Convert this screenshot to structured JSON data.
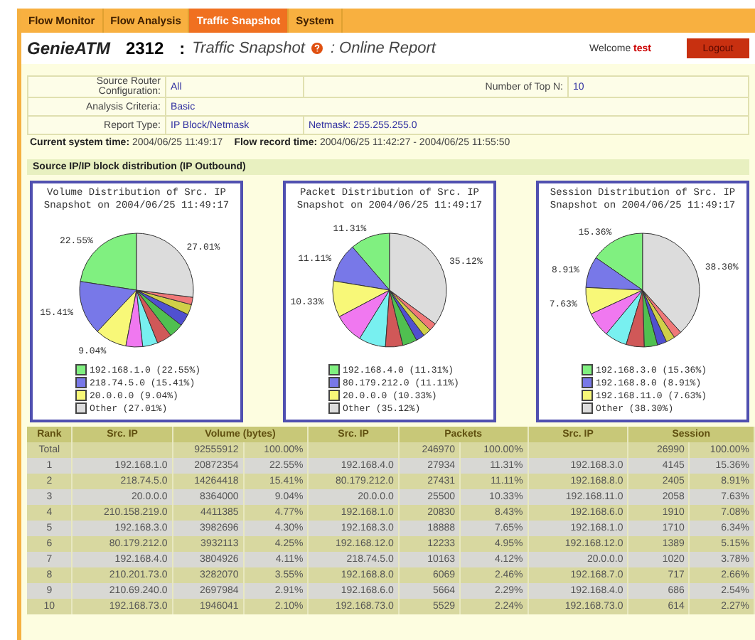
{
  "nav": [
    {
      "label": "Flow Monitor",
      "selected": false
    },
    {
      "label": "Flow Analysis",
      "selected": false
    },
    {
      "label": "Traffic Snapshot",
      "selected": true
    },
    {
      "label": "System",
      "selected": false
    }
  ],
  "header": {
    "product": "GenieATM",
    "model": "2312",
    "separator": ":",
    "section": "Traffic Snapshot",
    "page": ": Online Report",
    "welcome": "Welcome",
    "user": "test",
    "logout": "Logout"
  },
  "filters": {
    "source_label": "Source Router Configuration:",
    "source_value": "All",
    "topn_label": "Number of Top N:",
    "topn_value": "10",
    "criteria_label": "Analysis Criteria:",
    "criteria_value": "Basic",
    "report_label": "Report Type:",
    "report_value": "IP Block/Netmask",
    "netmask": "Netmask: 255.255.255.0"
  },
  "times": {
    "system_label": "Current system time:",
    "system_value": "2004/06/25 11:49:17",
    "flow_label": "Flow record time:",
    "flow_value": "2004/06/25 11:42:27 - 2004/06/25 11:55:50"
  },
  "section_title": "Source IP/IP block distribution (IP Outbound)",
  "charts": [
    {
      "title_lines": [
        "Volume Distribution of Src. IP",
        "Snapshot on 2004/06/25 11:49:17"
      ],
      "chart_data": {
        "type": "pie",
        "values": [
          22.55,
          15.41,
          9.04,
          4.77,
          4.3,
          4.25,
          4.11,
          3.55,
          2.91,
          2.1,
          27.01
        ],
        "colors": [
          "#80f080",
          "#7878e8",
          "#f8f878",
          "#f078f0",
          "#78f0f0",
          "#d05858",
          "#50c050",
          "#5050d0",
          "#d0d048",
          "#f07878",
          "#dcdcdc"
        ],
        "value_labels": [
          "22.55%",
          "15.41%",
          "9.04%",
          null,
          null,
          null,
          null,
          null,
          null,
          null,
          "27.01%"
        ]
      },
      "legend": [
        {
          "label": "192.168.1.0 (22.55%)",
          "color": "#80f080"
        },
        {
          "label": "218.74.5.0 (15.41%)",
          "color": "#7878e8"
        },
        {
          "label": "20.0.0.0 (9.04%)",
          "color": "#f8f878"
        },
        {
          "label": "Other (27.01%)",
          "color": "#dcdcdc"
        }
      ]
    },
    {
      "title_lines": [
        "Packet Distribution of Src. IP",
        "Snapshot on 2004/06/25 11:49:17"
      ],
      "chart_data": {
        "type": "pie",
        "values": [
          11.31,
          11.11,
          10.33,
          8.43,
          7.65,
          4.95,
          4.12,
          2.46,
          2.29,
          2.24,
          35.12
        ],
        "colors": [
          "#80f080",
          "#7878e8",
          "#f8f878",
          "#f078f0",
          "#78f0f0",
          "#d05858",
          "#50c050",
          "#5050d0",
          "#d0d048",
          "#f07878",
          "#dcdcdc"
        ],
        "value_labels": [
          "11.31%",
          "11.11%",
          "10.33%",
          null,
          null,
          null,
          null,
          null,
          null,
          null,
          "35.12%"
        ]
      },
      "legend": [
        {
          "label": "192.168.4.0 (11.31%)",
          "color": "#80f080"
        },
        {
          "label": "80.179.212.0 (11.11%)",
          "color": "#7878e8"
        },
        {
          "label": "20.0.0.0 (10.33%)",
          "color": "#f8f878"
        },
        {
          "label": "Other (35.12%)",
          "color": "#dcdcdc"
        }
      ]
    },
    {
      "title_lines": [
        "Session Distribution of Src. IP",
        "Snapshot on 2004/06/25 11:49:17"
      ],
      "chart_data": {
        "type": "pie",
        "values": [
          15.36,
          8.91,
          7.63,
          7.08,
          6.34,
          5.15,
          3.78,
          2.66,
          2.54,
          2.27,
          38.3
        ],
        "colors": [
          "#80f080",
          "#7878e8",
          "#f8f878",
          "#f078f0",
          "#78f0f0",
          "#d05858",
          "#50c050",
          "#5050d0",
          "#d0d048",
          "#f07878",
          "#dcdcdc"
        ],
        "value_labels": [
          "15.36%",
          "8.91%",
          "7.63%",
          null,
          null,
          null,
          null,
          null,
          null,
          null,
          "38.30%"
        ]
      },
      "legend": [
        {
          "label": "192.168.3.0 (15.36%)",
          "color": "#80f080"
        },
        {
          "label": "192.168.8.0 (8.91%)",
          "color": "#7878e8"
        },
        {
          "label": "192.168.11.0 (7.63%)",
          "color": "#f8f878"
        },
        {
          "label": "Other (38.30%)",
          "color": "#dcdcdc"
        }
      ]
    }
  ],
  "table": {
    "columns": [
      {
        "label": "Rank",
        "kind": "single"
      },
      {
        "label": "Src. IP",
        "kind": "single"
      },
      {
        "label": "Volume (bytes)",
        "kind": "pair"
      },
      {
        "label": "Src. IP",
        "kind": "single"
      },
      {
        "label": "Packets",
        "kind": "pair"
      },
      {
        "label": "Src. IP",
        "kind": "single"
      },
      {
        "label": "Session",
        "kind": "pair"
      }
    ],
    "total": {
      "label": "Total",
      "volume": [
        "92555912",
        "100.00%"
      ],
      "packets": [
        "246970",
        "100.00%"
      ],
      "session": [
        "26990",
        "100.00%"
      ]
    },
    "rows": [
      [
        "1",
        "192.168.1.0",
        [
          "20872354",
          "22.55%"
        ],
        "192.168.4.0",
        [
          "27934",
          "11.31%"
        ],
        "192.168.3.0",
        [
          "4145",
          "15.36%"
        ]
      ],
      [
        "2",
        "218.74.5.0",
        [
          "14264418",
          "15.41%"
        ],
        "80.179.212.0",
        [
          "27431",
          "11.11%"
        ],
        "192.168.8.0",
        [
          "2405",
          "8.91%"
        ]
      ],
      [
        "3",
        "20.0.0.0",
        [
          "8364000",
          "9.04%"
        ],
        "20.0.0.0",
        [
          "25500",
          "10.33%"
        ],
        "192.168.11.0",
        [
          "2058",
          "7.63%"
        ]
      ],
      [
        "4",
        "210.158.219.0",
        [
          "4411385",
          "4.77%"
        ],
        "192.168.1.0",
        [
          "20830",
          "8.43%"
        ],
        "192.168.6.0",
        [
          "1910",
          "7.08%"
        ]
      ],
      [
        "5",
        "192.168.3.0",
        [
          "3982696",
          "4.30%"
        ],
        "192.168.3.0",
        [
          "18888",
          "7.65%"
        ],
        "192.168.1.0",
        [
          "1710",
          "6.34%"
        ]
      ],
      [
        "6",
        "80.179.212.0",
        [
          "3932113",
          "4.25%"
        ],
        "192.168.12.0",
        [
          "12233",
          "4.95%"
        ],
        "192.168.12.0",
        [
          "1389",
          "5.15%"
        ]
      ],
      [
        "7",
        "192.168.4.0",
        [
          "3804926",
          "4.11%"
        ],
        "218.74.5.0",
        [
          "10163",
          "4.12%"
        ],
        "20.0.0.0",
        [
          "1020",
          "3.78%"
        ]
      ],
      [
        "8",
        "210.201.73.0",
        [
          "3282070",
          "3.55%"
        ],
        "192.168.8.0",
        [
          "6069",
          "2.46%"
        ],
        "192.168.7.0",
        [
          "717",
          "2.66%"
        ]
      ],
      [
        "9",
        "210.69.240.0",
        [
          "2697984",
          "2.91%"
        ],
        "192.168.6.0",
        [
          "5664",
          "2.29%"
        ],
        "192.168.4.0",
        [
          "686",
          "2.54%"
        ]
      ],
      [
        "10",
        "192.168.73.0",
        [
          "1946041",
          "2.10%"
        ],
        "192.168.73.0",
        [
          "5529",
          "2.24%"
        ],
        "192.168.73.0",
        [
          "614",
          "2.27%"
        ]
      ]
    ]
  }
}
